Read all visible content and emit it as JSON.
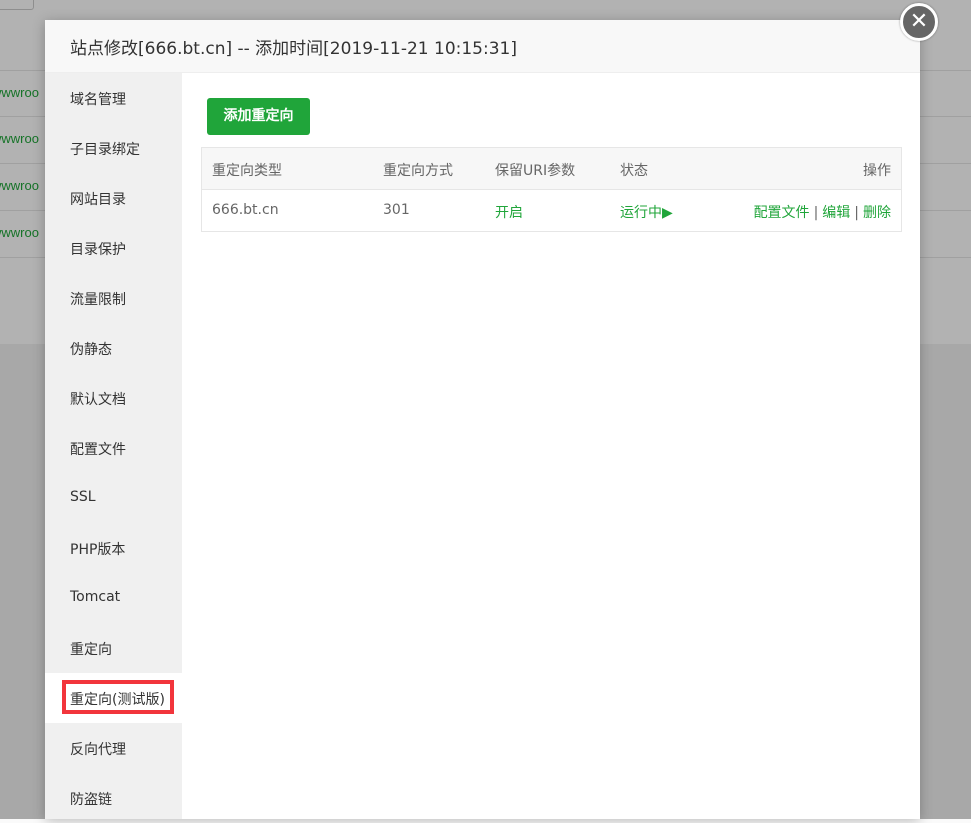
{
  "background": {
    "row_links": [
      "wwwroo",
      "wwwroo",
      "wwwroo",
      "wwwroo"
    ]
  },
  "modal": {
    "title": "站点修改[666.bt.cn] -- 添加时间[2019-11-21 10:15:31]",
    "close_icon": "close-icon"
  },
  "sidebar": {
    "items": [
      {
        "label": "域名管理"
      },
      {
        "label": "子目录绑定"
      },
      {
        "label": "网站目录"
      },
      {
        "label": "目录保护"
      },
      {
        "label": "流量限制"
      },
      {
        "label": "伪静态"
      },
      {
        "label": "默认文档"
      },
      {
        "label": "配置文件"
      },
      {
        "label": "SSL"
      },
      {
        "label": "PHP版本"
      },
      {
        "label": "Tomcat"
      },
      {
        "label": "重定向"
      },
      {
        "label": "重定向(测试版)"
      },
      {
        "label": "反向代理"
      },
      {
        "label": "防盗链"
      }
    ],
    "active_index": 12
  },
  "toolbar": {
    "add_label": "添加重定向"
  },
  "table": {
    "headers": [
      "重定向类型",
      "重定向方式",
      "保留URI参数",
      "状态",
      "操作"
    ],
    "rows": [
      {
        "type": "666.bt.cn",
        "method": "301",
        "keep_uri": "开启",
        "status": "运行中▶",
        "actions": [
          "配置文件",
          "编辑",
          "删除"
        ]
      }
    ]
  },
  "colors": {
    "accent": "#20a53a",
    "highlight_border": "#f2353c"
  }
}
